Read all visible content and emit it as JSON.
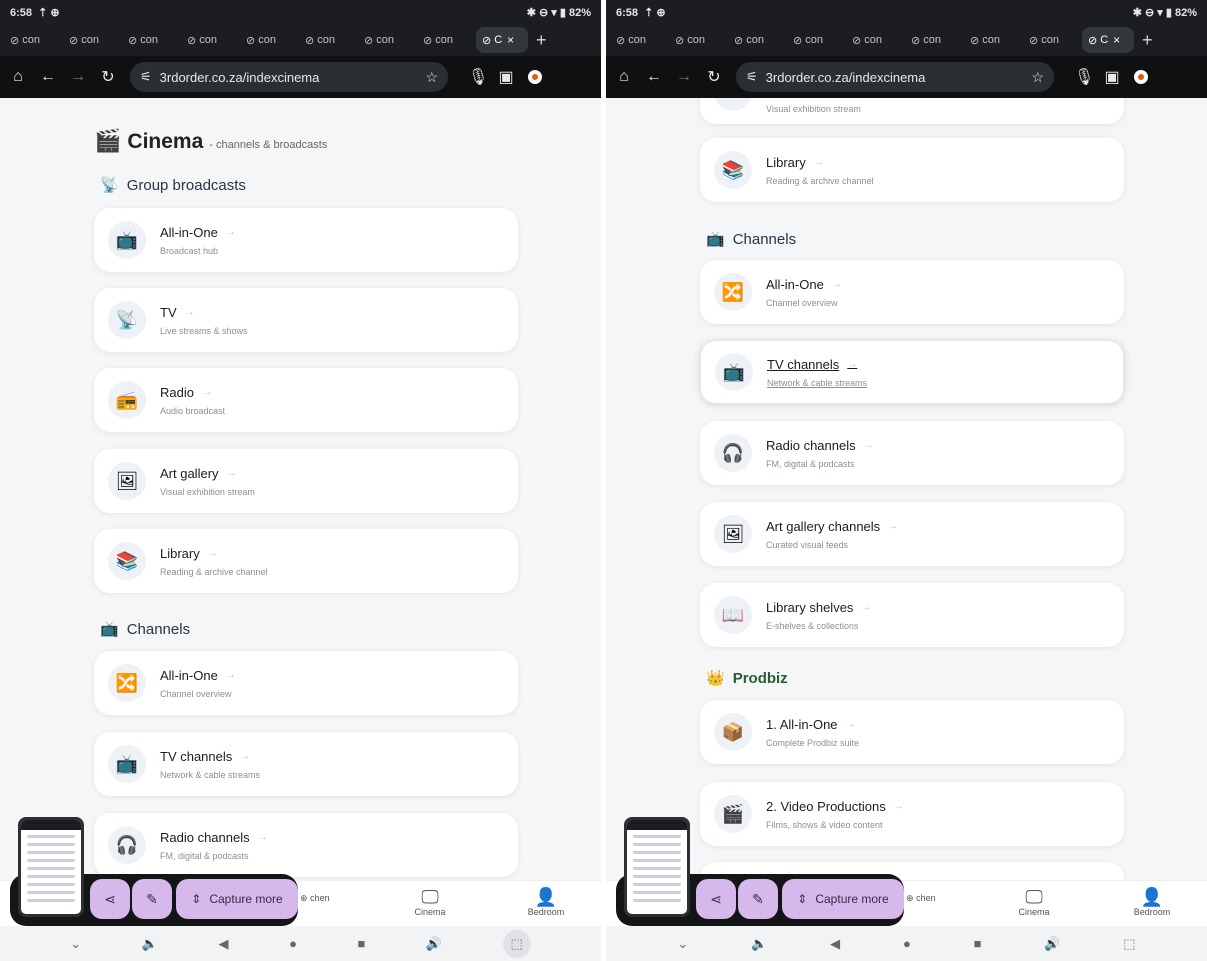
{
  "status": {
    "time": "6:58",
    "icons_left": "⇡ ⊕",
    "icons_right": "✱ ⊖ ▾ ▮",
    "battery": "82%"
  },
  "tabs": {
    "inactive_label": "con",
    "active_label": "C",
    "close": "×",
    "new": "+"
  },
  "toolbar": {
    "url": "3rdorder.co.za/indexcinema"
  },
  "page": {
    "title": "Cinema",
    "subtitle": "- channels & broadcasts"
  },
  "sections": {
    "group": "Group broadcasts",
    "channels": "Channels",
    "prodbiz": "Prodbiz"
  },
  "group_cards": [
    {
      "title": "All-in-One",
      "desc": "Broadcast hub",
      "icon": "📺"
    },
    {
      "title": "TV",
      "desc": "Live streams & shows",
      "icon": "📡"
    },
    {
      "title": "Radio",
      "desc": "Audio broadcast",
      "icon": "📻"
    },
    {
      "title": "Art gallery",
      "desc": "Visual exhibition stream",
      "icon": "🖼"
    },
    {
      "title": "Library",
      "desc": "Reading & archive channel",
      "icon": "📚"
    }
  ],
  "channel_cards": [
    {
      "title": "All-in-One",
      "desc": "Channel overview",
      "icon": "🔀"
    },
    {
      "title": "TV channels",
      "desc": "Network & cable streams",
      "icon": "📺"
    },
    {
      "title": "Radio channels",
      "desc": "FM, digital & podcasts",
      "icon": "🎧"
    },
    {
      "title": "Art gallery channels",
      "desc": "Curated visual feeds",
      "icon": "🖼"
    },
    {
      "title": "Library shelves",
      "desc": "E-shelves & collections",
      "icon": "📖"
    }
  ],
  "prodbiz_cards": [
    {
      "title": "1. All-in-One",
      "desc": "Complete Prodbiz suite",
      "icon": "📦"
    },
    {
      "title": "2. Video Productions",
      "desc": "Films, shows & video content",
      "icon": "🎬"
    }
  ],
  "right_top_partial_desc": "Visual exhibition stream",
  "bottomnav": {
    "kitchen": "chen",
    "cinema": "Cinema",
    "bedroom": "Bedroom"
  },
  "capture": {
    "more": "Capture more"
  }
}
